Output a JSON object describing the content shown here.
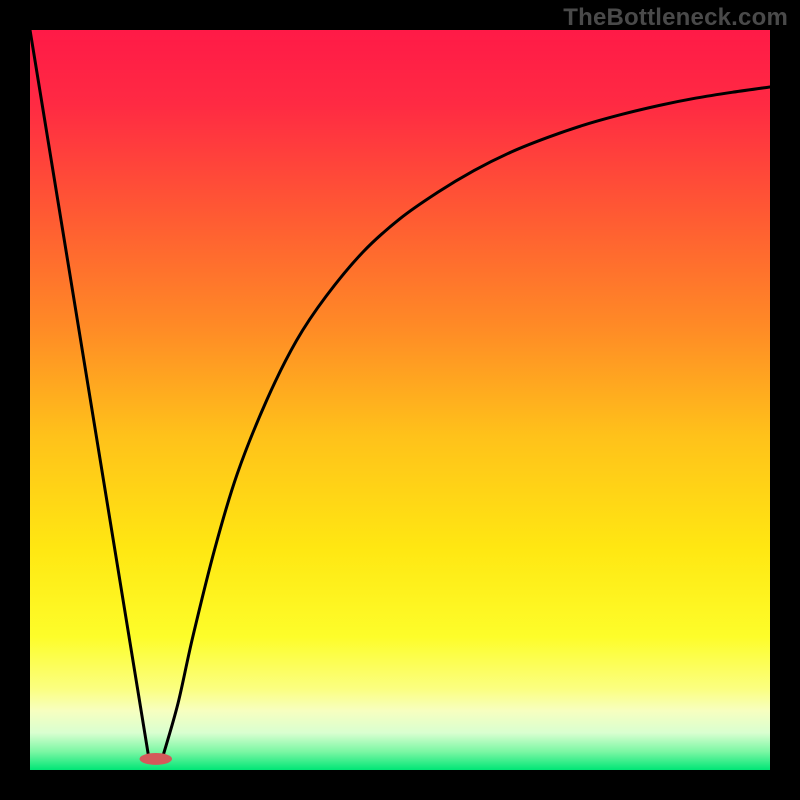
{
  "watermark": "TheBottleneck.com",
  "chart_data": {
    "type": "line",
    "title": "",
    "xlabel": "",
    "ylabel": "",
    "xlim": [
      0,
      100
    ],
    "ylim": [
      0,
      100
    ],
    "grid": false,
    "legend": false,
    "background_gradient": {
      "stops": [
        {
          "offset": 0.0,
          "color": "#ff1a47"
        },
        {
          "offset": 0.1,
          "color": "#ff2a43"
        },
        {
          "offset": 0.25,
          "color": "#ff5a33"
        },
        {
          "offset": 0.4,
          "color": "#ff8a26"
        },
        {
          "offset": 0.55,
          "color": "#ffc21a"
        },
        {
          "offset": 0.7,
          "color": "#ffe712"
        },
        {
          "offset": 0.82,
          "color": "#fdfd2a"
        },
        {
          "offset": 0.89,
          "color": "#fbff80"
        },
        {
          "offset": 0.92,
          "color": "#f7ffc0"
        },
        {
          "offset": 0.95,
          "color": "#d9ffd0"
        },
        {
          "offset": 0.975,
          "color": "#7cf7a4"
        },
        {
          "offset": 1.0,
          "color": "#00e676"
        }
      ]
    },
    "series": [
      {
        "name": "left-line",
        "type": "line",
        "x": [
          0,
          16
        ],
        "y": [
          100,
          2
        ],
        "color": "#000000",
        "width": 3
      },
      {
        "name": "right-curve",
        "type": "line",
        "x": [
          18,
          20,
          22,
          25,
          28,
          32,
          36,
          40,
          45,
          50,
          55,
          60,
          65,
          70,
          75,
          80,
          85,
          90,
          95,
          100
        ],
        "y": [
          2,
          9,
          18,
          30,
          40,
          50,
          58,
          64,
          70,
          74.5,
          78,
          81,
          83.5,
          85.5,
          87.2,
          88.6,
          89.8,
          90.8,
          91.6,
          92.3
        ],
        "color": "#000000",
        "width": 3
      }
    ],
    "marker": {
      "name": "min-point",
      "x": 17,
      "y": 1.5,
      "rx": 2.2,
      "ry": 0.8,
      "color": "#d45a5a"
    }
  }
}
